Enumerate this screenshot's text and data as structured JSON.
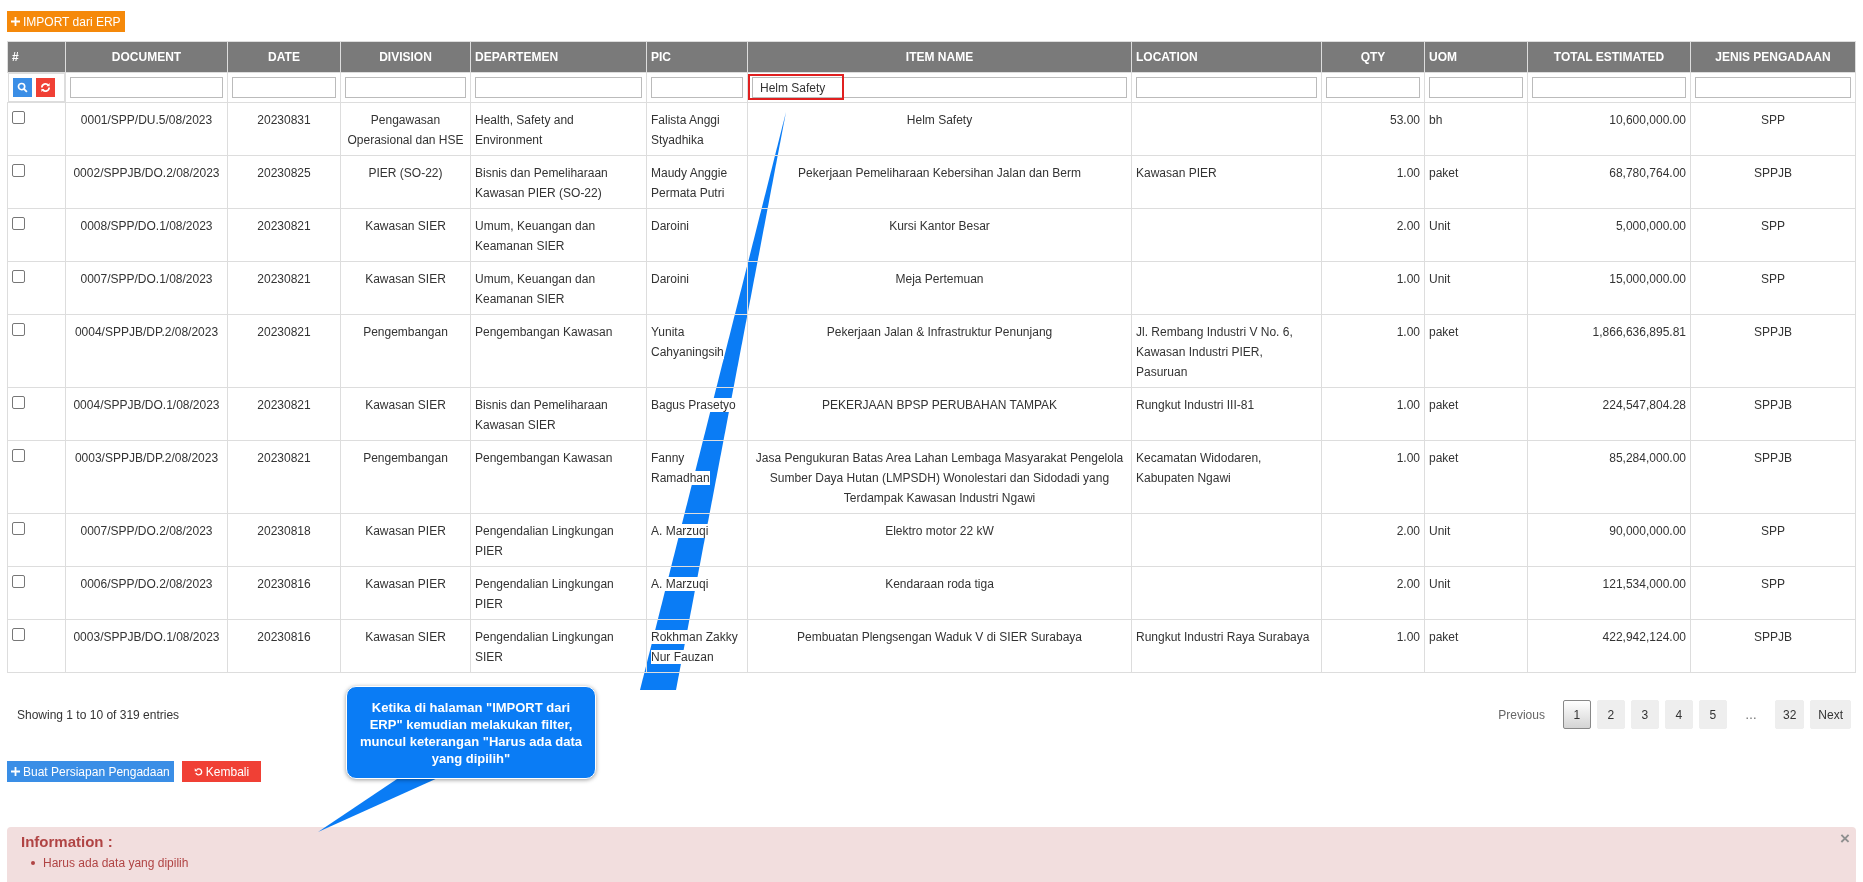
{
  "import_button": "IMPORT dari ERP",
  "table": {
    "columns": [
      "#",
      "DOCUMENT",
      "DATE",
      "DIVISION",
      "DEPARTEMEN",
      "PIC",
      "ITEM NAME",
      "LOCATION",
      "QTY",
      "UOM",
      "TOTAL ESTIMATED",
      "JENIS PENGADAAN"
    ],
    "filters": [
      {
        "highlighted": false
      },
      {
        "highlighted": false
      },
      {
        "highlighted": false
      },
      {
        "highlighted": false
      },
      {
        "highlighted": false
      },
      {
        "value": "Helm Safety",
        "highlighted": true
      },
      {
        "highlighted": false
      },
      {
        "highlighted": false
      },
      {
        "highlighted": false
      },
      {
        "highlighted": false
      },
      {
        "highlighted": false
      }
    ],
    "rows": [
      {
        "checked": false,
        "cells": [
          "",
          "0001/SPP/DU.5/08/2023",
          "20230831",
          "Pengawasan Operasional dan HSE",
          "Health, Safety and Environment",
          "Falista Anggi Styadhika",
          "Helm Safety",
          "",
          "53.00",
          "bh",
          "10,600,000.00",
          "SPP"
        ]
      },
      {
        "checked": false,
        "cells": [
          "",
          "0002/SPPJB/DO.2/08/2023",
          "20230825",
          "PIER (SO-22)",
          "Bisnis dan Pemeliharaan Kawasan PIER (SO-22)",
          "Maudy Anggie Permata Putri",
          "Pekerjaan Pemeliharaan Kebersihan Jalan dan Berm",
          "Kawasan PIER",
          "1.00",
          "paket",
          "68,780,764.00",
          "SPPJB"
        ]
      },
      {
        "checked": false,
        "cells": [
          "",
          "0008/SPP/DO.1/08/2023",
          "20230821",
          "Kawasan SIER",
          "Umum, Keuangan dan Keamanan SIER",
          "Daroini",
          "Kursi Kantor Besar",
          "",
          "2.00",
          "Unit",
          "5,000,000.00",
          "SPP"
        ]
      },
      {
        "checked": false,
        "cells": [
          "",
          "0007/SPP/DO.1/08/2023",
          "20230821",
          "Kawasan SIER",
          "Umum, Keuangan dan Keamanan SIER",
          "Daroini",
          "Meja Pertemuan",
          "",
          "1.00",
          "Unit",
          "15,000,000.00",
          "SPP"
        ]
      },
      {
        "checked": false,
        "cells": [
          "",
          "0004/SPPJB/DP.2/08/2023",
          "20230821",
          "Pengembangan",
          "Pengembangan Kawasan",
          "Yunita Cahyaningsih",
          "Pekerjaan Jalan & Infrastruktur Penunjang",
          "Jl. Rembang Industri V No. 6, Kawasan Industri PIER, Pasuruan",
          "1.00",
          "paket",
          "1,866,636,895.81",
          "SPPJB"
        ]
      },
      {
        "checked": false,
        "cells": [
          "",
          "0004/SPPJB/DO.1/08/2023",
          "20230821",
          "Kawasan SIER",
          "Bisnis dan Pemeliharaan Kawasan SIER",
          "Bagus Prasetyo",
          "PEKERJAAN BPSP PERUBAHAN TAMPAK",
          "Rungkut Industri III-81",
          "1.00",
          "paket",
          "224,547,804.28",
          "SPPJB"
        ]
      },
      {
        "checked": false,
        "cells": [
          "",
          "0003/SPPJB/DP.2/08/2023",
          "20230821",
          "Pengembangan",
          "Pengembangan Kawasan",
          "Fanny Ramadhan",
          "Jasa Pengukuran Batas Area Lahan Lembaga Masyarakat Pengelola Sumber Daya Hutan (LMPSDH) Wonolestari dan Sidodadi yang Terdampak Kawasan Industri Ngawi",
          "Kecamatan Widodaren, Kabupaten Ngawi",
          "1.00",
          "paket",
          "85,284,000.00",
          "SPPJB"
        ]
      },
      {
        "checked": false,
        "cells": [
          "",
          "0007/SPP/DO.2/08/2023",
          "20230818",
          "Kawasan PIER",
          "Pengendalian Lingkungan PIER",
          "A. Marzuqi",
          "Elektro motor 22 kW",
          "",
          "2.00",
          "Unit",
          "90,000,000.00",
          "SPP"
        ]
      },
      {
        "checked": false,
        "cells": [
          "",
          "0006/SPP/DO.2/08/2023",
          "20230816",
          "Kawasan PIER",
          "Pengendalian Lingkungan PIER",
          "A. Marzuqi",
          "Kendaraan roda tiga",
          "",
          "2.00",
          "Unit",
          "121,534,000.00",
          "SPP"
        ]
      },
      {
        "checked": false,
        "cells": [
          "",
          "0003/SPPJB/DO.1/08/2023",
          "20230816",
          "Kawasan SIER",
          "Pengendalian Lingkungan SIER",
          "Rokhman Zakky Nur Fauzan",
          "Pembuatan Plengsengan Waduk V di SIER Surabaya",
          "Rungkut Industri Raya Surabaya",
          "1.00",
          "paket",
          "422,942,124.00",
          "SPPJB"
        ]
      }
    ]
  },
  "info_text": "Showing 1 to 10 of 319 entries",
  "pagination": [
    {
      "label": "Previous",
      "kind": "text",
      "selected": false
    },
    {
      "label": "1",
      "kind": "page",
      "selected": true
    },
    {
      "label": "2",
      "kind": "page",
      "selected": false
    },
    {
      "label": "3",
      "kind": "page",
      "selected": false
    },
    {
      "label": "4",
      "kind": "page",
      "selected": false
    },
    {
      "label": "5",
      "kind": "page",
      "selected": false
    },
    {
      "label": "…",
      "kind": "text",
      "selected": false
    },
    {
      "label": "32",
      "kind": "page",
      "selected": false
    },
    {
      "label": "Next",
      "kind": "page",
      "selected": false
    }
  ],
  "actions": [
    {
      "label": "Buat Persiapan Pengadaan",
      "kind": "create"
    },
    {
      "label": "Kembali",
      "kind": "back"
    }
  ],
  "callout": "Ketika di halaman \"IMPORT dari ERP\" kemudian melakukan filter, muncul keterangan \"Harus ada data yang dipilih\"",
  "alert": {
    "title": "Information :",
    "close": "×",
    "items": [
      "Harus ada data yang dipilih"
    ]
  }
}
